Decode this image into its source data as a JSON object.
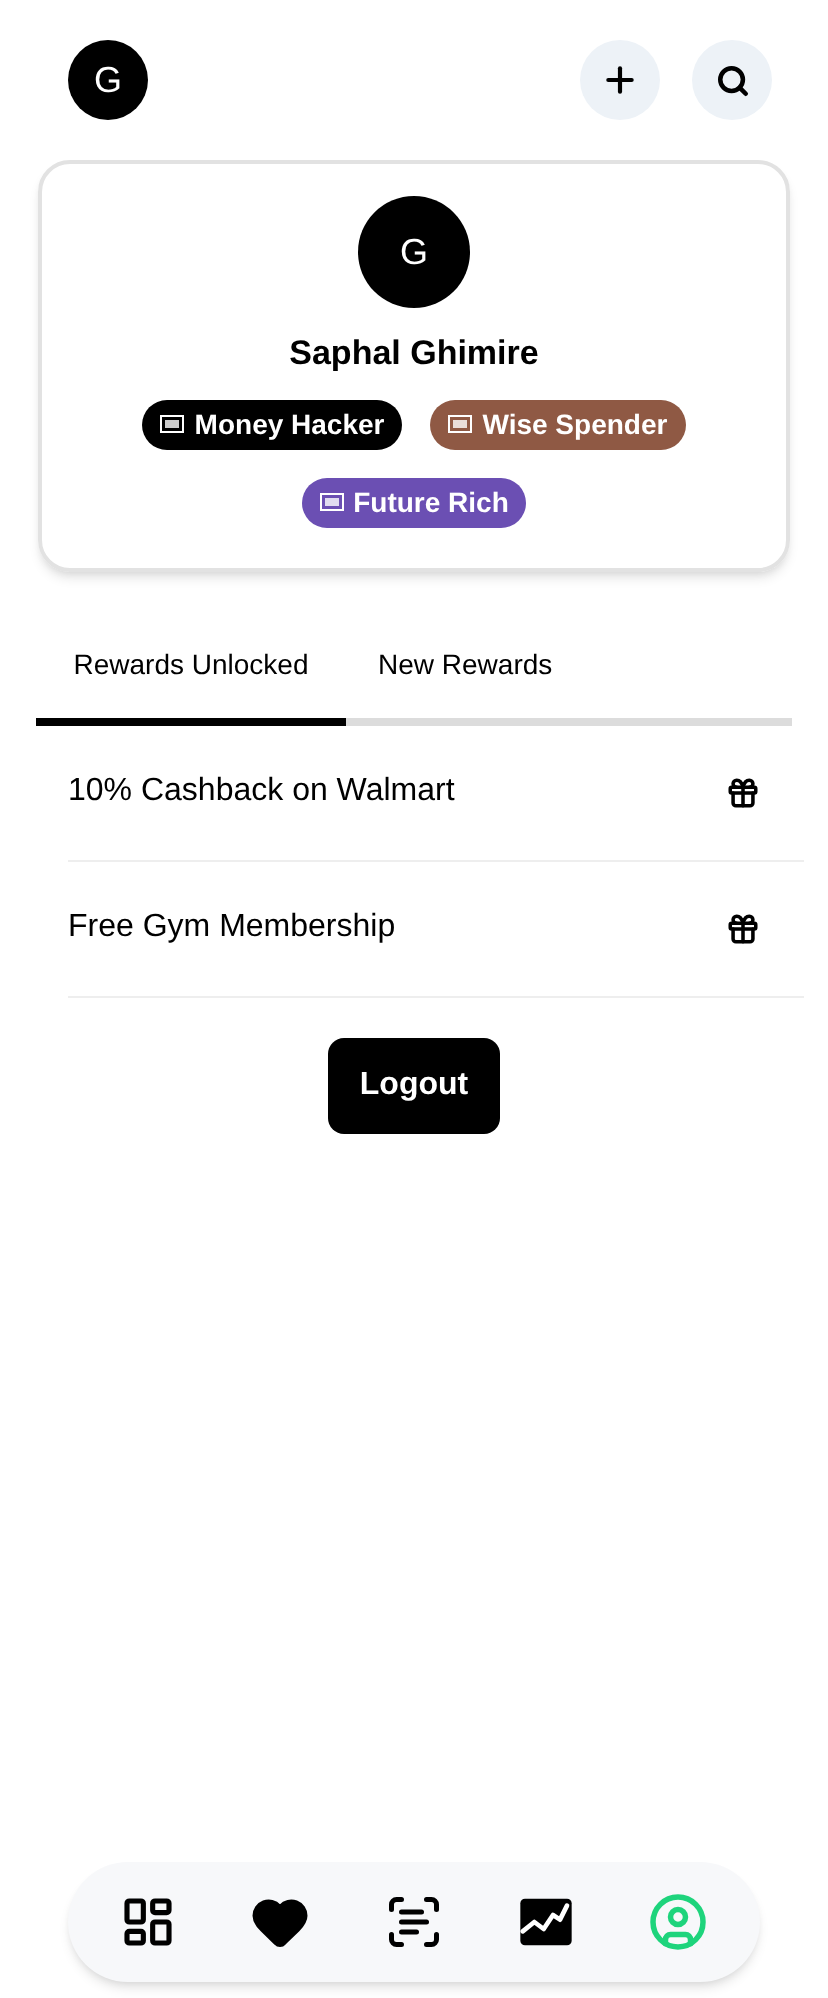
{
  "header": {
    "avatar_initial": "G"
  },
  "profile": {
    "avatar_initial": "G",
    "name": "Saphal Ghimire",
    "badges": [
      {
        "label": "Money Hacker",
        "color": "#000000"
      },
      {
        "label": "Wise Spender",
        "color": "#8f5944"
      },
      {
        "label": "Future Rich",
        "color": "#6b4fb3"
      }
    ]
  },
  "tabs": [
    {
      "label": "Rewards Unlocked",
      "selected": true
    },
    {
      "label": "New Rewards",
      "selected": false
    }
  ],
  "rewards": [
    {
      "title": "10% Cashback on Walmart"
    },
    {
      "title": "Free Gym Membership"
    }
  ],
  "logout": {
    "label": "Logout"
  },
  "nav": [
    {
      "kind": "dashboard",
      "selected": false
    },
    {
      "kind": "favorites",
      "selected": false
    },
    {
      "kind": "scan",
      "selected": false
    },
    {
      "kind": "chart",
      "selected": false
    },
    {
      "kind": "profile",
      "selected": true
    }
  ]
}
